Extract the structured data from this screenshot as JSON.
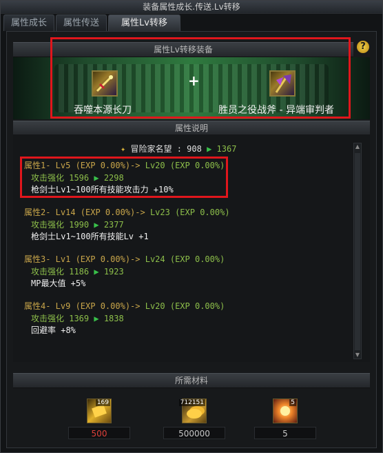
{
  "window": {
    "title": "装备属性成长.传送.Lv转移"
  },
  "tabs": [
    {
      "label": "属性成长"
    },
    {
      "label": "属性传送"
    },
    {
      "label": "属性Lv转移"
    }
  ],
  "help": {
    "label": "?"
  },
  "transfer": {
    "header": "属性Lv转移装备",
    "plus": "+",
    "source_item": "吞噬本源长刀",
    "target_item": "胜员之役战斧 - 异端审判者"
  },
  "attributes": {
    "header": "属性说明",
    "reputation": {
      "label": "冒险家名望 : 908",
      "arrow": "▶",
      "new": "1367"
    },
    "items": [
      {
        "title": "属性1- Lv5 (EXP 0.00%)-> ",
        "target": "Lv20 (EXP 0.00%)",
        "stat_label": "攻击强化 1596",
        "arrow": "▶",
        "stat_new": "2298",
        "extra": "枪剑士Lv1~100所有技能攻击力 +10%"
      },
      {
        "title": "属性2- Lv14 (EXP 0.00%)-> ",
        "target": "Lv23 (EXP 0.00%)",
        "stat_label": "攻击强化 1990",
        "arrow": "▶",
        "stat_new": "2377",
        "extra": "枪剑士Lv1~100所有技能Lv +1"
      },
      {
        "title": "属性3- Lv1 (EXP 0.00%)-> ",
        "target": "Lv24 (EXP 0.00%)",
        "stat_label": "攻击强化 1186",
        "arrow": "▶",
        "stat_new": "1923",
        "extra": "MP最大值 +5%"
      },
      {
        "title": "属性4- Lv9 (EXP 0.00%)-> ",
        "target": "Lv20 (EXP 0.00%)",
        "stat_label": "攻击强化 1369",
        "arrow": "▶",
        "stat_new": "1838",
        "extra": "回避率 +8%"
      }
    ]
  },
  "materials": {
    "header": "所需材料",
    "items": [
      {
        "icon": "gold-crystal-icon",
        "count": "169",
        "required": "500",
        "required_color": "#e0403a"
      },
      {
        "icon": "gold-coins-icon",
        "count": "712151",
        "required": "500000",
        "required_color": "#c8c8c8"
      },
      {
        "icon": "fire-orb-icon",
        "count": "5",
        "required": "5",
        "required_color": "#c8c8c8"
      }
    ]
  }
}
